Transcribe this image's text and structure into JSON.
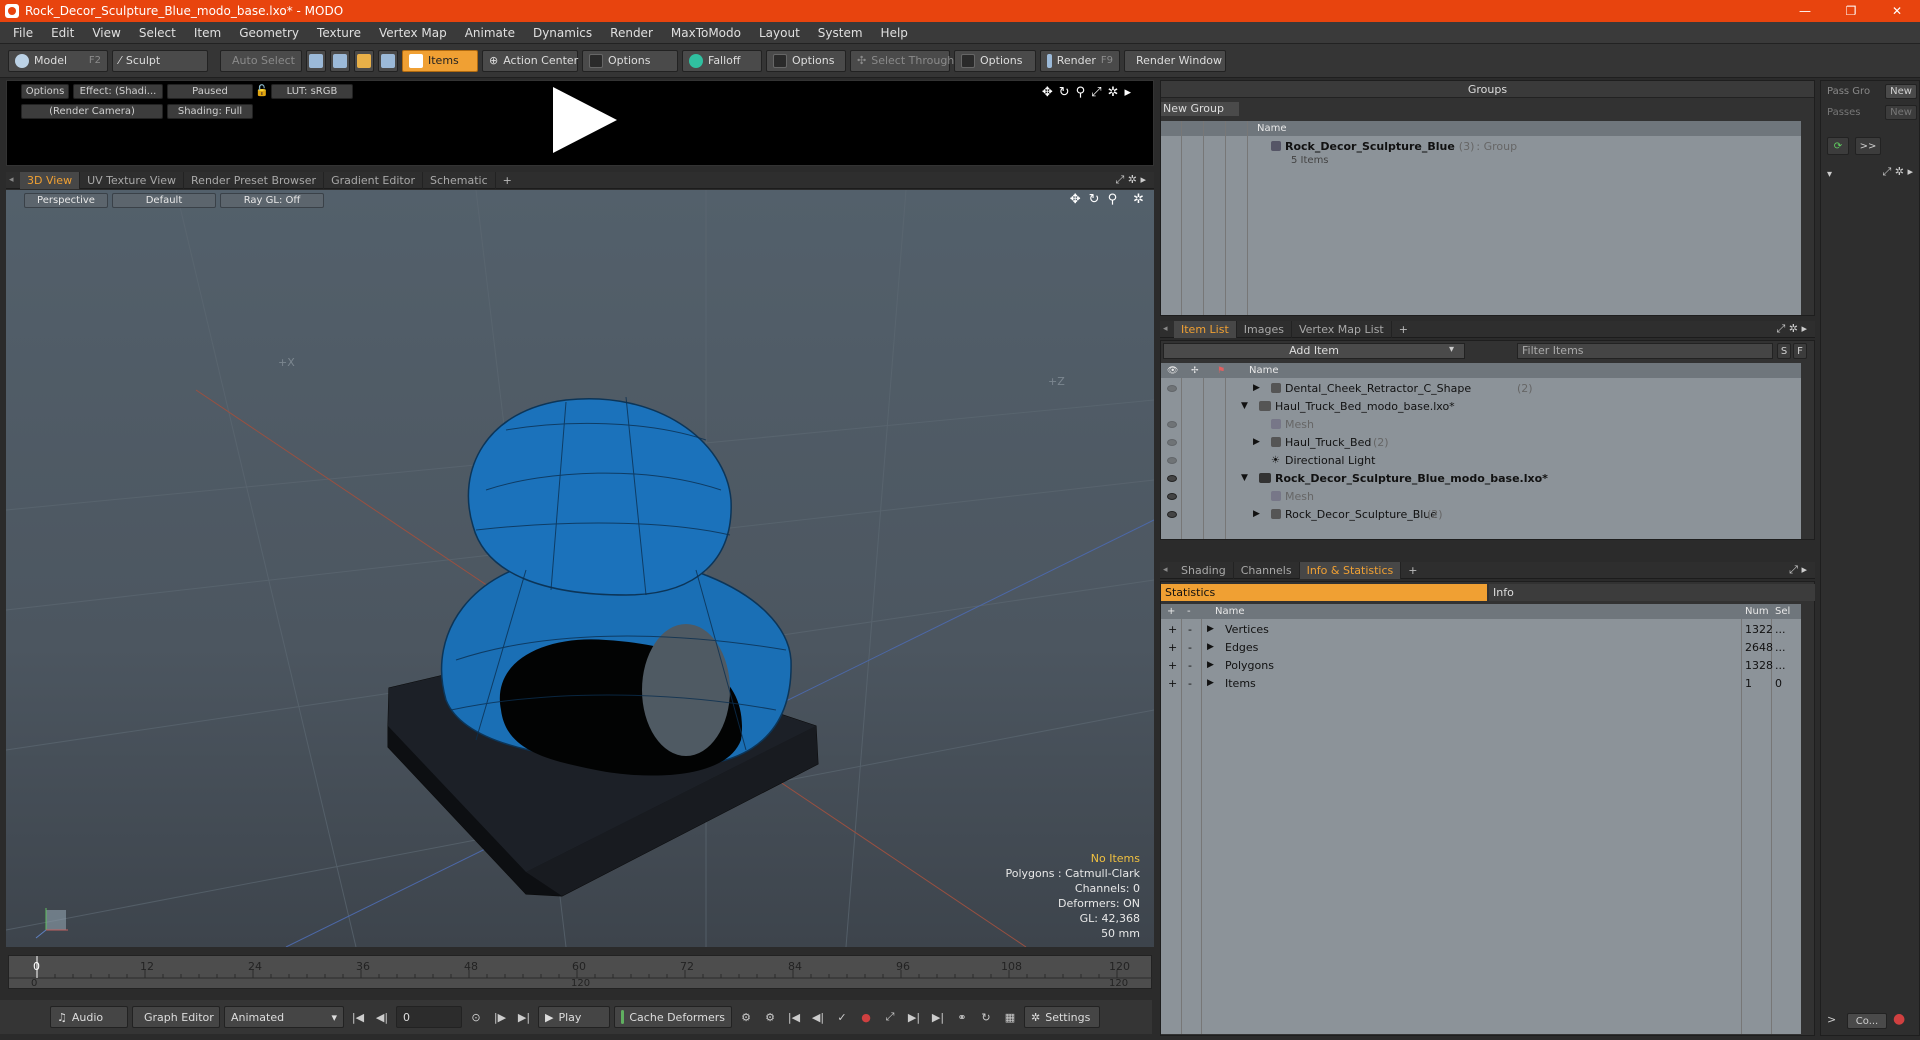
{
  "window": {
    "title": "Rock_Decor_Sculpture_Blue_modo_base.lxo* - MODO",
    "controls": [
      "—",
      "❐",
      "✕"
    ]
  },
  "menu": [
    "File",
    "Edit",
    "View",
    "Select",
    "Item",
    "Geometry",
    "Texture",
    "Vertex Map",
    "Animate",
    "Dynamics",
    "Render",
    "MaxToModo",
    "Layout",
    "System",
    "Help"
  ],
  "toolbar": {
    "model": "Model",
    "model_key": "F2",
    "sculpt": "Sculpt",
    "auto_select": "Auto Select",
    "items": "Items",
    "action_center": "Action Center",
    "options": "Options",
    "falloff": "Falloff",
    "select_through": "Select Through",
    "render": "Render",
    "render_key": "F9",
    "render_window": "Render Window"
  },
  "preview": {
    "options": "Options",
    "effect": "Effect: (Shadi...",
    "paused": "Paused",
    "lut": "LUT: sRGB",
    "camera": "(Render Camera)",
    "shading": "Shading: Full"
  },
  "viewport_tabs": [
    "3D View",
    "UV Texture View",
    "Render Preset Browser",
    "Gradient Editor",
    "Schematic",
    "+"
  ],
  "viewport": {
    "perspective": "Perspective",
    "default": "Default",
    "raygl": "Ray GL: Off",
    "axis_x": "+X",
    "axis_z": "+Z",
    "stats": [
      "No Items",
      "Polygons : Catmull-Clark",
      "Channels: 0",
      "Deformers: ON",
      "GL: 42,368",
      "50 mm"
    ]
  },
  "timeline": {
    "ticks": [
      "0",
      "12",
      "24",
      "36",
      "48",
      "60",
      "72",
      "84",
      "96",
      "108",
      "120"
    ],
    "range": [
      "0",
      "120",
      "120"
    ]
  },
  "bottom": {
    "audio": "Audio",
    "graph": "Graph Editor",
    "animated": "Animated",
    "frame": "0",
    "play": "Play",
    "cache": "Cache Deformers",
    "settings": "Settings"
  },
  "groups": {
    "title": "Groups",
    "new_group": "New Group",
    "col_name": "Name",
    "item_name": "Rock_Decor_Sculpture_Blue",
    "item_count": "(3)",
    "item_type": ": Group",
    "item_sub": "5 Items"
  },
  "passes": {
    "pass_grp": "Pass Gro",
    "passes": "Passes",
    "new": "New",
    "new2": "New",
    "more": ">>",
    "co": "Co..."
  },
  "itemlist": {
    "tabs": [
      "Item List",
      "Images",
      "Vertex Map List",
      "+"
    ],
    "add_item": "Add Item",
    "filter": "Filter Items",
    "s": "S",
    "f": "F",
    "col_name": "Name",
    "rows": [
      {
        "label": "Dental_Cheek_Retractor_C_Shape",
        "count": "(2)"
      },
      {
        "label": "Haul_Truck_Bed_modo_base.lxo*",
        "count": ""
      },
      {
        "label": "Mesh",
        "count": ""
      },
      {
        "label": "Haul_Truck_Bed",
        "count": "(2)"
      },
      {
        "label": "Directional Light",
        "count": ""
      },
      {
        "label": "Rock_Decor_Sculpture_Blue_modo_base.lxo*",
        "count": ""
      },
      {
        "label": "Mesh",
        "count": ""
      },
      {
        "label": "Rock_Decor_Sculpture_Blue",
        "count": "(2)"
      }
    ]
  },
  "info": {
    "tabs": [
      "Shading",
      "Channels",
      "Info & Statistics",
      "+"
    ],
    "statistics": "Statistics",
    "info": "Info",
    "cols": {
      "name": "Name",
      "num": "Num",
      "sel": "Sel"
    },
    "rows": [
      {
        "name": "Vertices",
        "num": "1322",
        "sel": "..."
      },
      {
        "name": "Edges",
        "num": "2648",
        "sel": "..."
      },
      {
        "name": "Polygons",
        "num": "1328",
        "sel": "..."
      },
      {
        "name": "Items",
        "num": "1",
        "sel": "0"
      }
    ]
  }
}
